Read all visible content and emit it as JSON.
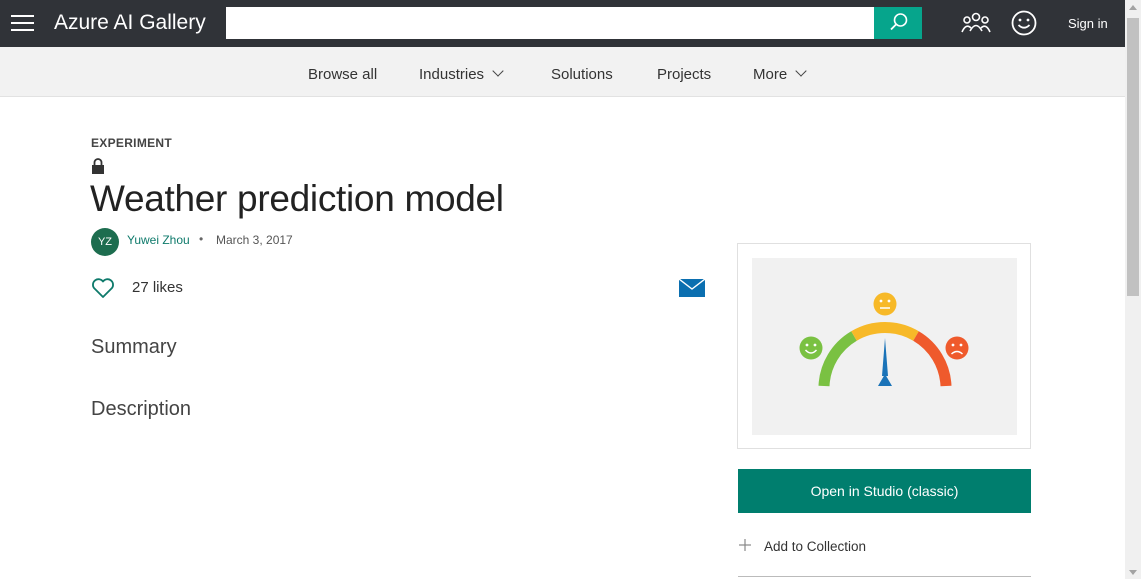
{
  "header": {
    "brand": "Azure AI Gallery",
    "search_placeholder": "",
    "sign_in_label": "Sign in",
    "icons": [
      "menu-icon",
      "search-icon",
      "community-icon",
      "feedback-smile-icon"
    ]
  },
  "nav": {
    "items": [
      {
        "label": "Browse all",
        "has_dropdown": false
      },
      {
        "label": "Industries",
        "has_dropdown": true
      },
      {
        "label": "Solutions",
        "has_dropdown": false
      },
      {
        "label": "Projects",
        "has_dropdown": false
      },
      {
        "label": "More",
        "has_dropdown": true
      }
    ]
  },
  "item": {
    "type_label": "EXPERIMENT",
    "title": "Weather prediction model",
    "author_initials": "YZ",
    "author_name": "Yuwei Zhou",
    "separator": "•",
    "date": "March 3, 2017",
    "likes_label": "27 likes",
    "summary_heading": "Summary",
    "description_heading": "Description"
  },
  "sidebar": {
    "open_button_label": "Open in Studio (classic)",
    "add_collection_label": "Add to Collection",
    "thumbnail_icon": "sentiment-gauge-illustration"
  },
  "colors": {
    "topbar_bg": "#303338",
    "search_button": "#06a58c",
    "primary_button": "#007e6e",
    "author_link": "#0e7a6b",
    "avatar_bg": "#1d6d4f",
    "gauge_green": "#7ac142",
    "gauge_yellow": "#f7b928",
    "gauge_red": "#ef5a2c",
    "needle": "#1a73b8"
  }
}
